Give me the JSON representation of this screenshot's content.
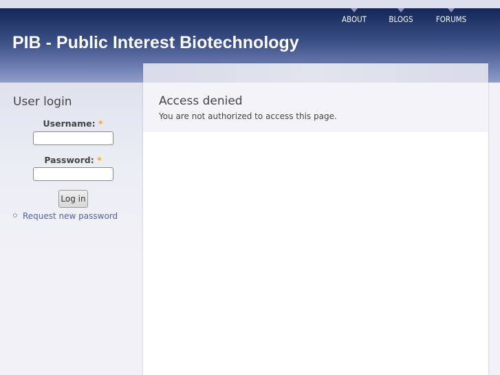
{
  "header": {
    "site_title": "PIB - Public Interest Biotechnology",
    "nav": [
      {
        "label": "ABOUT"
      },
      {
        "label": "BLOGS"
      },
      {
        "label": "FORUMS"
      }
    ]
  },
  "sidebar": {
    "block_title": "User login",
    "username_label": "Username:",
    "password_label": "Password:",
    "required_marker": "*",
    "login_button": "Log in",
    "request_password_link": "Request new password"
  },
  "main": {
    "title": "Access denied",
    "message": "You are not authorized to access this page."
  }
}
